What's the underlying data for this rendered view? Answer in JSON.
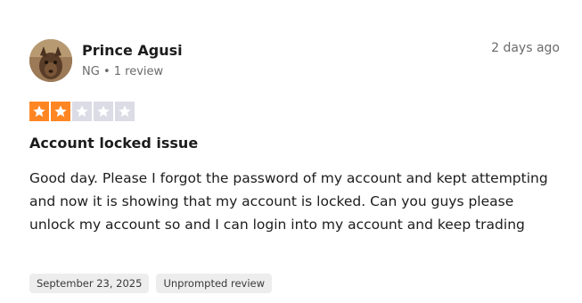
{
  "reviewer": {
    "name": "Prince Agusi",
    "country": "NG",
    "separator": "•",
    "review_count": "1 review"
  },
  "review": {
    "posted_relative": "2 days ago",
    "rating": 2,
    "rating_max": 5,
    "star_filled_color": "#ff8622",
    "star_empty_color": "#dcdce6",
    "title": "Account locked issue",
    "body": "Good day. Please I forgot the password of my account and kept attempting and now it is showing that my account is locked. Can you guys please unlock my account so and I can login into my account and keep trading",
    "tags": [
      "September 23, 2025",
      "Unprompted review"
    ]
  }
}
